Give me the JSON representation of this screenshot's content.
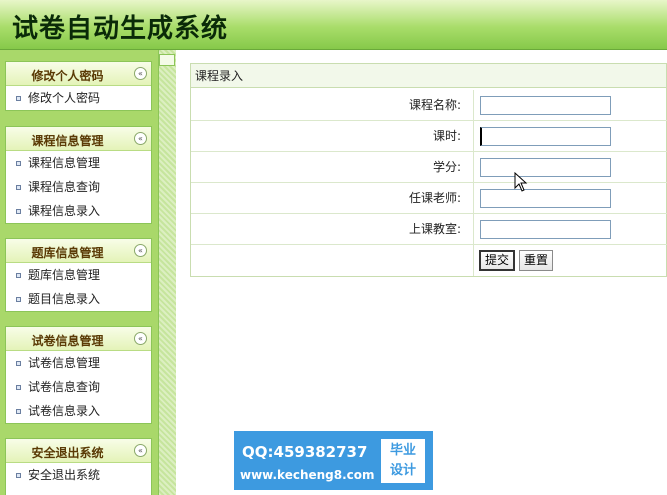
{
  "header": {
    "title": "试卷自动生成系统"
  },
  "sidebar": {
    "groups": [
      {
        "title": "修改个人密码",
        "toggle": "«",
        "items": [
          "修改个人密码"
        ]
      },
      {
        "title": "课程信息管理",
        "toggle": "«",
        "items": [
          "课程信息管理",
          "课程信息查询",
          "课程信息录入"
        ]
      },
      {
        "title": "题库信息管理",
        "toggle": "«",
        "items": [
          "题库信息管理",
          "题目信息录入"
        ]
      },
      {
        "title": "试卷信息管理",
        "toggle": "«",
        "items": [
          "试卷信息管理",
          "试卷信息查询",
          "试卷信息录入"
        ]
      },
      {
        "title": "安全退出系统",
        "toggle": "«",
        "items": [
          "安全退出系统"
        ]
      }
    ]
  },
  "form": {
    "title": "课程录入",
    "fields": [
      {
        "label": "课程名称:",
        "value": ""
      },
      {
        "label": "课时:",
        "value": ""
      },
      {
        "label": "学分:",
        "value": ""
      },
      {
        "label": "任课老师:",
        "value": ""
      },
      {
        "label": "上课教室:",
        "value": ""
      }
    ],
    "submit_label": "提交",
    "reset_label": "重置"
  },
  "watermark": {
    "qq": "QQ:459382737",
    "site": "www.kecheng8.com",
    "badge_line1": "毕业",
    "badge_line2": "设计"
  }
}
